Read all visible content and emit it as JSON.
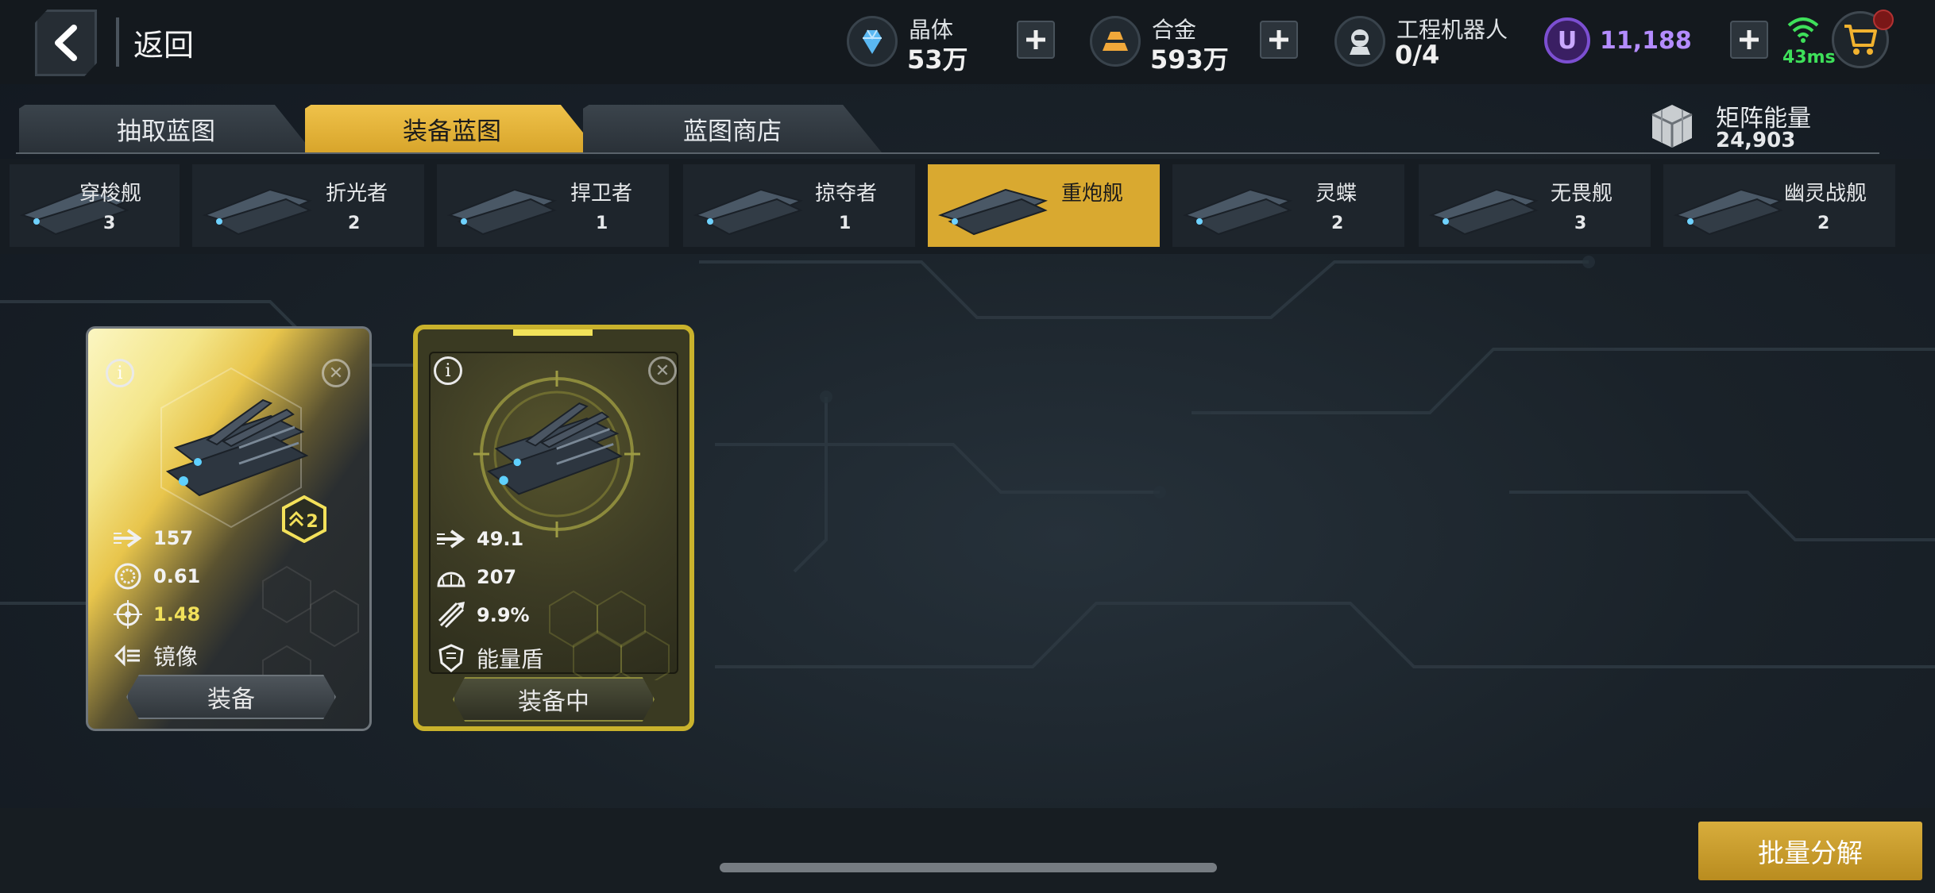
{
  "header": {
    "back_label": "返回",
    "resources": [
      {
        "name": "晶体",
        "value": "53万",
        "icon": "crystal-icon"
      },
      {
        "name": "合金",
        "value": "593万",
        "icon": "alloy-icon"
      },
      {
        "name": "工程机器人",
        "value": "0/4",
        "icon": "robot-icon"
      }
    ],
    "premium_value": "11,188",
    "premium_letter": "U",
    "ping": "43ms"
  },
  "tabs": [
    {
      "label": "抽取蓝图",
      "active": false
    },
    {
      "label": "装备蓝图",
      "active": true
    },
    {
      "label": "蓝图商店",
      "active": false
    }
  ],
  "matrix_energy": {
    "label": "矩阵能量",
    "value": "24,903"
  },
  "ship_classes": [
    {
      "name": "穿梭舰",
      "count": "3",
      "active": false
    },
    {
      "name": "折光者",
      "count": "2",
      "active": false
    },
    {
      "name": "捍卫者",
      "count": "1",
      "active": false
    },
    {
      "name": "掠夺者",
      "count": "1",
      "active": false
    },
    {
      "name": "重炮舰",
      "count": "",
      "active": true
    },
    {
      "name": "灵蝶",
      "count": "2",
      "active": false
    },
    {
      "name": "无畏舰",
      "count": "3",
      "active": false
    },
    {
      "name": "幽灵战舰",
      "count": "2",
      "active": false
    }
  ],
  "cards": [
    {
      "tier": "2",
      "stats": [
        {
          "icon": "speed-arrow-icon",
          "value": "157",
          "highlight": false
        },
        {
          "icon": "rate-dial-icon",
          "value": "0.61",
          "highlight": false
        },
        {
          "icon": "crosshair-icon",
          "value": "1.48",
          "highlight": true
        }
      ],
      "ability": {
        "icon": "mirror-icon",
        "label": "镜像"
      },
      "button": "装备"
    },
    {
      "stats": [
        {
          "icon": "speed-arrow-icon",
          "value": "49.1",
          "highlight": false
        },
        {
          "icon": "armor-dial-icon",
          "value": "207",
          "highlight": false
        },
        {
          "icon": "missile-icon",
          "value": "9.9%",
          "highlight": false
        }
      ],
      "ability": {
        "icon": "shield-icon",
        "label": "能量盾"
      },
      "button": "装备中"
    }
  ],
  "footer": {
    "batch_label": "批量分解"
  }
}
